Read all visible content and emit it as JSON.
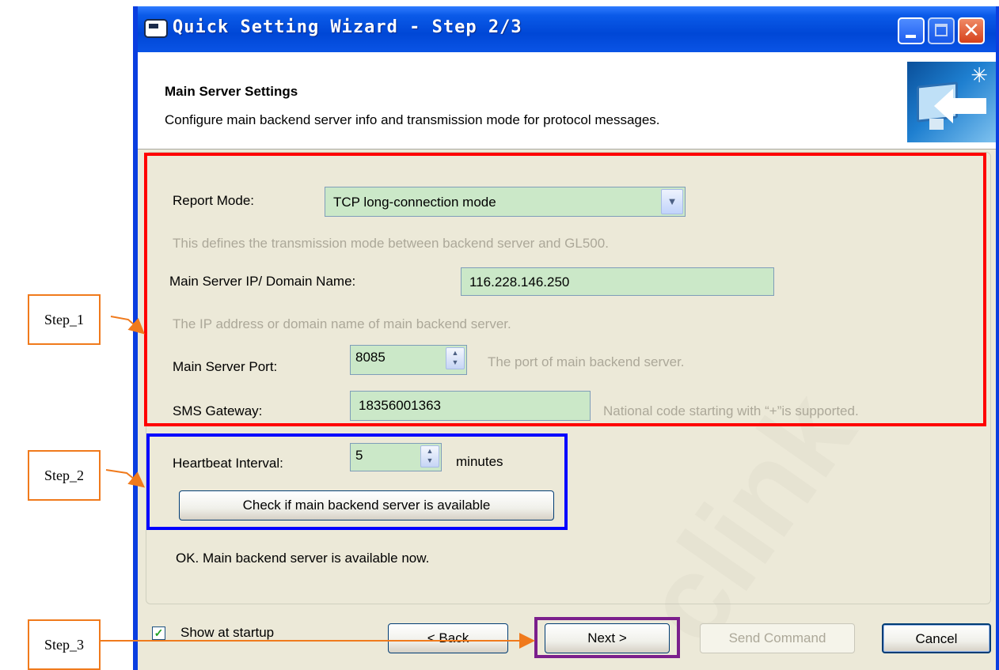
{
  "window": {
    "title": "Quick Setting Wizard - Step 2/3"
  },
  "header": {
    "title": "Main Server Settings",
    "description": "Configure main backend server info and transmission mode for protocol messages."
  },
  "form": {
    "report_mode": {
      "label": "Report Mode:",
      "value": "TCP long-connection mode",
      "hint": "This defines the transmission mode between backend server and GL500."
    },
    "server_ip": {
      "label": "Main Server IP/ Domain Name:",
      "value": "116.228.146.250",
      "hint": "The IP address or domain name of main backend server."
    },
    "server_port": {
      "label": "Main Server Port:",
      "value": "8085",
      "hint": "The port of main backend server."
    },
    "sms_gateway": {
      "label": "SMS Gateway:",
      "value": "18356001363",
      "hint": "National code starting with “+”is supported."
    },
    "heartbeat": {
      "label": "Heartbeat Interval:",
      "value": "5",
      "unit": "minutes"
    },
    "check_button": "Check if main backend server is available",
    "status": "OK. Main backend server is available now."
  },
  "footer": {
    "show_at_startup": "Show at startup",
    "show_at_startup_checked": true,
    "back": "< Back",
    "next": "Next >",
    "send_command": "Send Command",
    "cancel": "Cancel"
  },
  "annotations": {
    "step1": "Step_1",
    "step2": "Step_2",
    "step3": "Step_3",
    "colors": {
      "step1_box": "#ff0000",
      "step2_box": "#0000ff",
      "step3_box": "#7b1f8c",
      "arrow": "#f07a1c"
    }
  },
  "watermark": "clink",
  "colors": {
    "titlebar": "#0a54e6",
    "dialog_bg": "#ece9d8",
    "field_bg": "#cbe8c8",
    "hint_text": "#aca899"
  }
}
